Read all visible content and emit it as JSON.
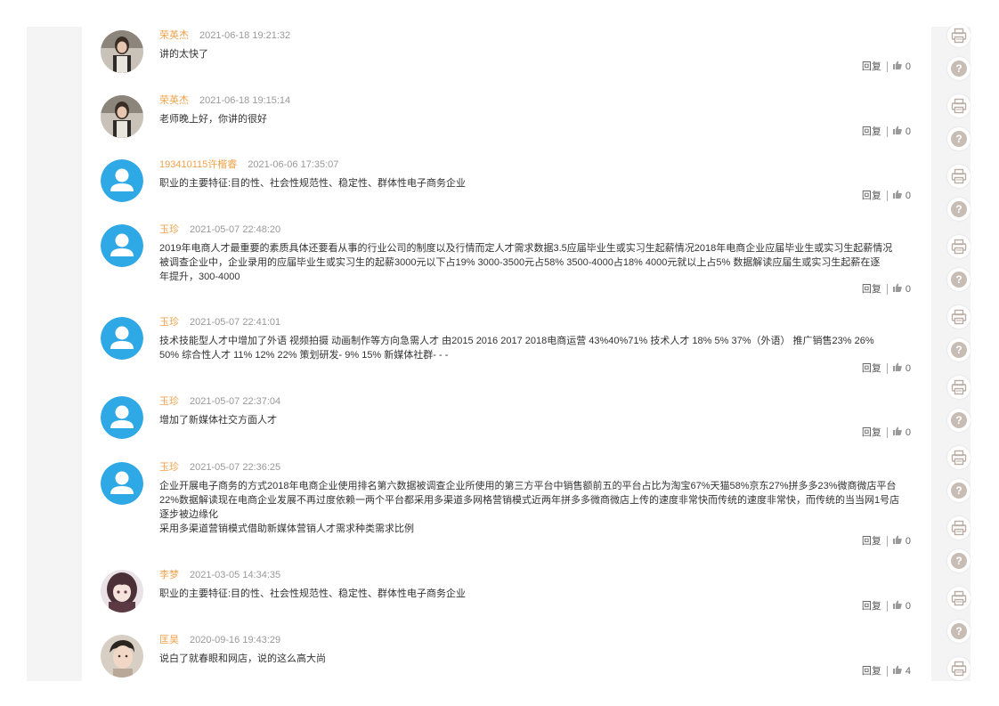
{
  "comments": [
    {
      "author": "荣英杰",
      "time": "2021-06-18 19:21:32",
      "lines": [
        "讲的太快了"
      ],
      "reply": "回复",
      "likes": "0",
      "avatar": "photo-woman-icon"
    },
    {
      "author": "荣英杰",
      "time": "2021-06-18 19:15:14",
      "lines": [
        "老师晚上好，你讲的很好"
      ],
      "reply": "回复",
      "likes": "0",
      "avatar": "photo-woman-icon"
    },
    {
      "author": "193410115许楷睿",
      "time": "2021-06-06 17:35:07",
      "lines": [
        "职业的主要特征:目的性、社会性规范性、稳定性、群体性电子商务企业"
      ],
      "reply": "回复",
      "likes": "0",
      "avatar": "default-user-icon"
    },
    {
      "author": "玉珍",
      "time": "2021-05-07 22:48:20",
      "lines": [
        "2019年电商人才最重要的素质具体还要看从事的行业公司的制度以及行情而定人才需求数据3.5应届毕业生或实习生起薪情况2018年电商企业应届毕业生或实习生起薪情况",
        "被调查企业中，企业录用的应届毕业生或实习生的起薪3000元以下占19% 3000-3500元占58% 3500-4000占18% 4000元就以上占5% 数据解读应届生或实习生起薪在逐",
        "年提升，300-4000"
      ],
      "reply": "回复",
      "likes": "0",
      "avatar": "default-user-icon"
    },
    {
      "author": "玉珍",
      "time": "2021-05-07 22:41:01",
      "lines": [
        "技术技能型人才中增加了外语 视频拍摄 动画制作等方向急需人才 由2015 2016 2017 2018电商运营 43%40%71% 技术人才 18% 5% 37%（外语） 推广销售23% 26%",
        "50% 综合性人才 11% 12% 22% 策划研发- 9% 15% 新媒体社群- - -"
      ],
      "reply": "回复",
      "likes": "0",
      "avatar": "default-user-icon"
    },
    {
      "author": "玉珍",
      "time": "2021-05-07 22:37:04",
      "lines": [
        "增加了新媒体社交方面人才"
      ],
      "reply": "回复",
      "likes": "0",
      "avatar": "default-user-icon"
    },
    {
      "author": "玉珍",
      "time": "2021-05-07 22:36:25",
      "lines": [
        "企业开展电子商务的方式2018年电商企业使用排名第六数据被调查企业所使用的第三方平台中销售额前五的平台占比为淘宝67%天猫58%京东27%拼多多23%微商微店平台",
        "22%数据解读现在电商企业发展不再过度依赖一两个平台都采用多渠道多网格营销模式近两年拼多多微商微店上传的速度非常快而传统的速度非常快，而传统的当当网1号店",
        "逐步被边缘化",
        "采用多渠道营销模式借助新媒体营销人才需求种类需求比例"
      ],
      "reply": "回复",
      "likes": "0",
      "avatar": "default-user-icon"
    },
    {
      "author": "李梦",
      "time": "2021-03-05 14:34:35",
      "lines": [
        "职业的主要特征:目的性、社会性规范性、稳定性、群体性电子商务企业"
      ],
      "reply": "回复",
      "likes": "0",
      "avatar": "anime-girl-icon"
    },
    {
      "author": "匡昊",
      "time": "2020-09-16 19:43:29",
      "lines": [
        "说白了就春眼和网店，说的这么高大尚"
      ],
      "reply": "回复",
      "likes": "4",
      "avatar": "photo-man-icon"
    }
  ],
  "right_rail": {
    "icons": [
      "question-icon",
      "printer-icon"
    ]
  },
  "colors": {
    "author": "#f0a24b",
    "avatar_blue": "#2fa9e6",
    "rail_bg": "#f4f4f4",
    "text": "#333333",
    "time": "#999999"
  }
}
